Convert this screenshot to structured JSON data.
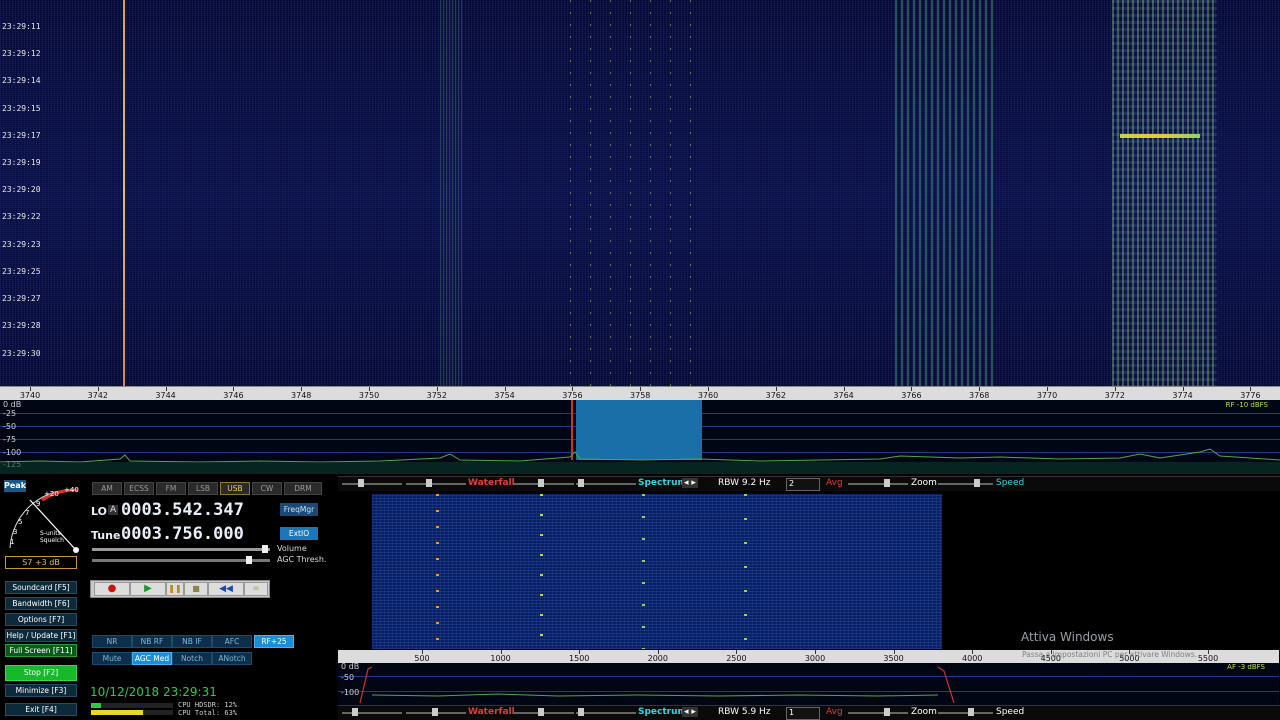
{
  "waterfall": {
    "times": [
      "23:29:11",
      "23:29:12",
      "23:29:14",
      "23:29:15",
      "23:29:17",
      "23:29:19",
      "23:29:20",
      "23:29:22",
      "23:29:23",
      "23:29:25",
      "23:29:27",
      "23:29:28",
      "23:29:30"
    ],
    "freq_labels": [
      "3740",
      "3742",
      "3744",
      "3746",
      "3748",
      "3750",
      "3752",
      "3754",
      "3756",
      "3758",
      "3760",
      "3762",
      "3764",
      "3766",
      "3768",
      "3770",
      "3772",
      "3774",
      "3776"
    ]
  },
  "spectrum": {
    "db_labels": [
      "0 dB",
      "-25",
      "-50",
      "-75",
      "-100",
      "-125"
    ],
    "rf_label": "RF -10 dBFS"
  },
  "strip_top": {
    "waterfall": "Waterfall",
    "spectrum": "Spectrum",
    "rbw": "RBW  9.2 Hz",
    "avg_value": "2",
    "avg": "Avg",
    "zoom": "Zoom",
    "speed": "Speed"
  },
  "smeter": {
    "peak": "Peak",
    "plus20": "+20",
    "plus40": "+40",
    "s9": "9",
    "s7": "7",
    "s5": "5",
    "s3": "3",
    "s1": "1",
    "s_units": "S-units",
    "squelch": "Squelch",
    "reading": "S7 +3 dB"
  },
  "modes": [
    "AM",
    "ECSS",
    "FM",
    "LSB",
    "USB",
    "CW",
    "DRM"
  ],
  "lo": {
    "label": "LO",
    "a": "A",
    "value": "0003.542.347",
    "btn": "FreqMgr"
  },
  "tune": {
    "label": "Tune",
    "value": "0003.756.000",
    "btn": "ExtIO"
  },
  "volume_label": "Volume",
  "agc_thresh_label": "AGC Thresh.",
  "side_buttons": [
    {
      "label": "Soundcard [F5]"
    },
    {
      "label": "Bandwidth [F6]"
    },
    {
      "label": "Options [F7]"
    },
    {
      "label": "Help / Update [F1]"
    },
    {
      "label": "Full Screen [F11]"
    },
    {
      "label": "Stop [F2]"
    },
    {
      "label": "Minimize [F3]"
    },
    {
      "label": "Exit [F4]"
    }
  ],
  "dsp_row1": [
    "NR",
    "NB RF",
    "NB IF",
    "AFC",
    "RF+25"
  ],
  "dsp_row2": [
    "Mute",
    "AGC Med",
    "Notch",
    "ANotch"
  ],
  "datetime": "10/12/2018 23:29:31",
  "cpu_hdsdr": "CPU HDSDR: 12%",
  "cpu_total": "CPU Total: 63%",
  "sub_scale": [
    "500",
    "1000",
    "1500",
    "2000",
    "2500",
    "3000",
    "3500",
    "4000",
    "4500",
    "5000",
    "5500"
  ],
  "sub_spectrum": {
    "db_labels": [
      "0 dB",
      "-50",
      "-100"
    ],
    "af_label": "AF -3 dBFS"
  },
  "strip_bottom": {
    "waterfall": "Waterfall",
    "spectrum": "Spectrum",
    "rbw": "RBW  5.9 Hz",
    "avg_value": "1",
    "avg": "Avg",
    "zoom": "Zoom",
    "speed": "Speed"
  },
  "watermark": {
    "title": "Attiva Windows",
    "sub": "Passa a Impostazioni PC per attivare Windows."
  },
  "colors": {
    "accent": "#21c7e6",
    "waterfall_red": "#e23b3b",
    "spectrum_cyan": "#2fd6e0",
    "speed_cyan": "#2fd6e0",
    "usb_active": "#d6c229",
    "rf25": "#2a9fe8"
  }
}
